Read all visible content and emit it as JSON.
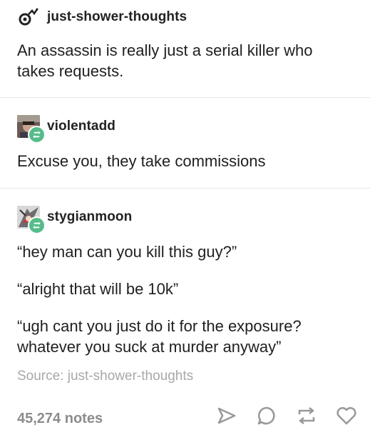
{
  "posts": [
    {
      "username": "just-shower-thoughts",
      "avatar": "comet-logo-icon",
      "reblogged": false,
      "paragraphs": [
        "An assassin is really just a serial killer who takes requests."
      ]
    },
    {
      "username": "violentadd",
      "avatar": "user-photo-avatar",
      "reblogged": true,
      "paragraphs": [
        "Excuse you, they take commissions"
      ]
    },
    {
      "username": "stygianmoon",
      "avatar": "anime-character-avatar",
      "reblogged": true,
      "paragraphs": [
        "“hey man can you kill this guy?”",
        "“alright that will be 10k”",
        "“ugh cant you just do it for the exposure? whatever you suck at murder anyway”"
      ]
    }
  ],
  "source_label": "Source: just-shower-thoughts",
  "notes_label": "45,274 notes",
  "actions": [
    "share-icon",
    "reply-icon",
    "reblog-icon",
    "like-icon"
  ],
  "colors": {
    "reblog_badge": "#56bc8a",
    "muted_text": "#a8a8a8",
    "icon": "#9a9a9a"
  }
}
